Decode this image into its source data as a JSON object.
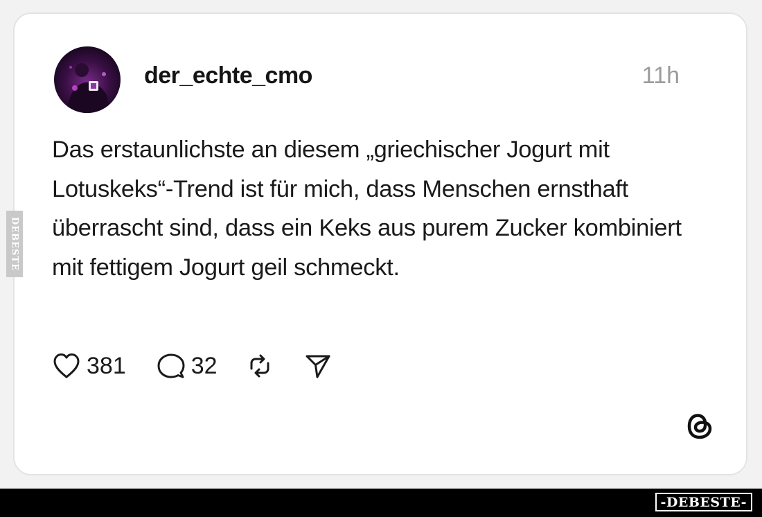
{
  "post": {
    "username": "der_echte_cmo",
    "time": "11h",
    "text": "Das erstaunlichste an diesem „griechischer Jogurt mit Lotuskeks“-Trend ist für mich, dass Menschen ernsthaft überrascht sind, dass ein Keks aus purem Zucker kombiniert mit fettigem Jogurt geil schmeckt.",
    "likes": "381",
    "comments": "32"
  },
  "icons": {
    "like": "heart-icon",
    "comment": "comment-bubble-icon",
    "repost": "repost-icon",
    "share": "send-icon",
    "platform": "threads-logo-icon"
  },
  "watermark": {
    "side": "DEBESTE",
    "bottom": "-DEBESTE-"
  },
  "colors": {
    "background": "#f2f2f2",
    "card": "#ffffff",
    "text": "#1a1a1a",
    "muted": "#9b9b9b",
    "bar": "#000000"
  }
}
